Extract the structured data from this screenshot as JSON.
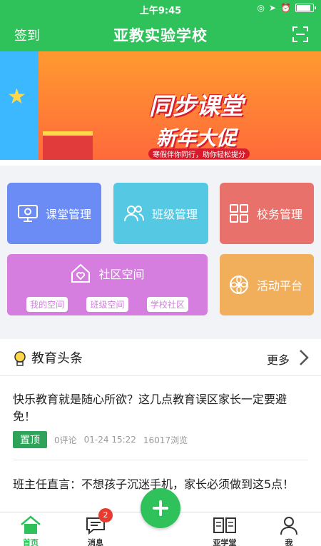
{
  "status_bar": {
    "time": "上午9:45",
    "icons": [
      "orientation-lock-icon",
      "location-icon",
      "alarm-icon",
      "battery-icon"
    ]
  },
  "header": {
    "left_label": "签到",
    "title": "亚教实验学校",
    "right_icon": "scan-icon"
  },
  "banner": {
    "line1": "同步课堂",
    "line2": "新年大促",
    "subtitle": "寒假伴你同行，助你轻松提分"
  },
  "tiles": {
    "classroom": {
      "label": "课堂管理",
      "icon": "monitor-gear-icon",
      "color": "#6b8bf5"
    },
    "class": {
      "label": "班级管理",
      "icon": "users-icon",
      "color": "#55c8e3"
    },
    "school": {
      "label": "校务管理",
      "icon": "grid-icon",
      "color": "#e8716b"
    },
    "community": {
      "label": "社区空间",
      "icon": "home-heart-icon",
      "color": "#d57ee0",
      "chips": [
        "我的空间",
        "班级空间",
        "学校社区"
      ]
    },
    "activity": {
      "label": "活动平台",
      "icon": "flower-icon",
      "color": "#f1ae5b"
    }
  },
  "news": {
    "title": "教育头条",
    "more": "更多",
    "articles": [
      {
        "title": "快乐教育就是随心所欲？这几点教育误区家长一定要避免！",
        "tag": "置顶",
        "comments": "0评论",
        "date": "01-24 15:22",
        "views": "16017浏览"
      },
      {
        "title": "班主任直言：不想孩子沉迷手机，家长必须做到这5点！"
      }
    ]
  },
  "bottom_nav": {
    "home": "首页",
    "messages": "消息",
    "message_badge": "2",
    "school_hall": "亚学堂",
    "me": "我"
  },
  "colors": {
    "accent": "#2fc25b",
    "badge": "#e63b2e"
  }
}
